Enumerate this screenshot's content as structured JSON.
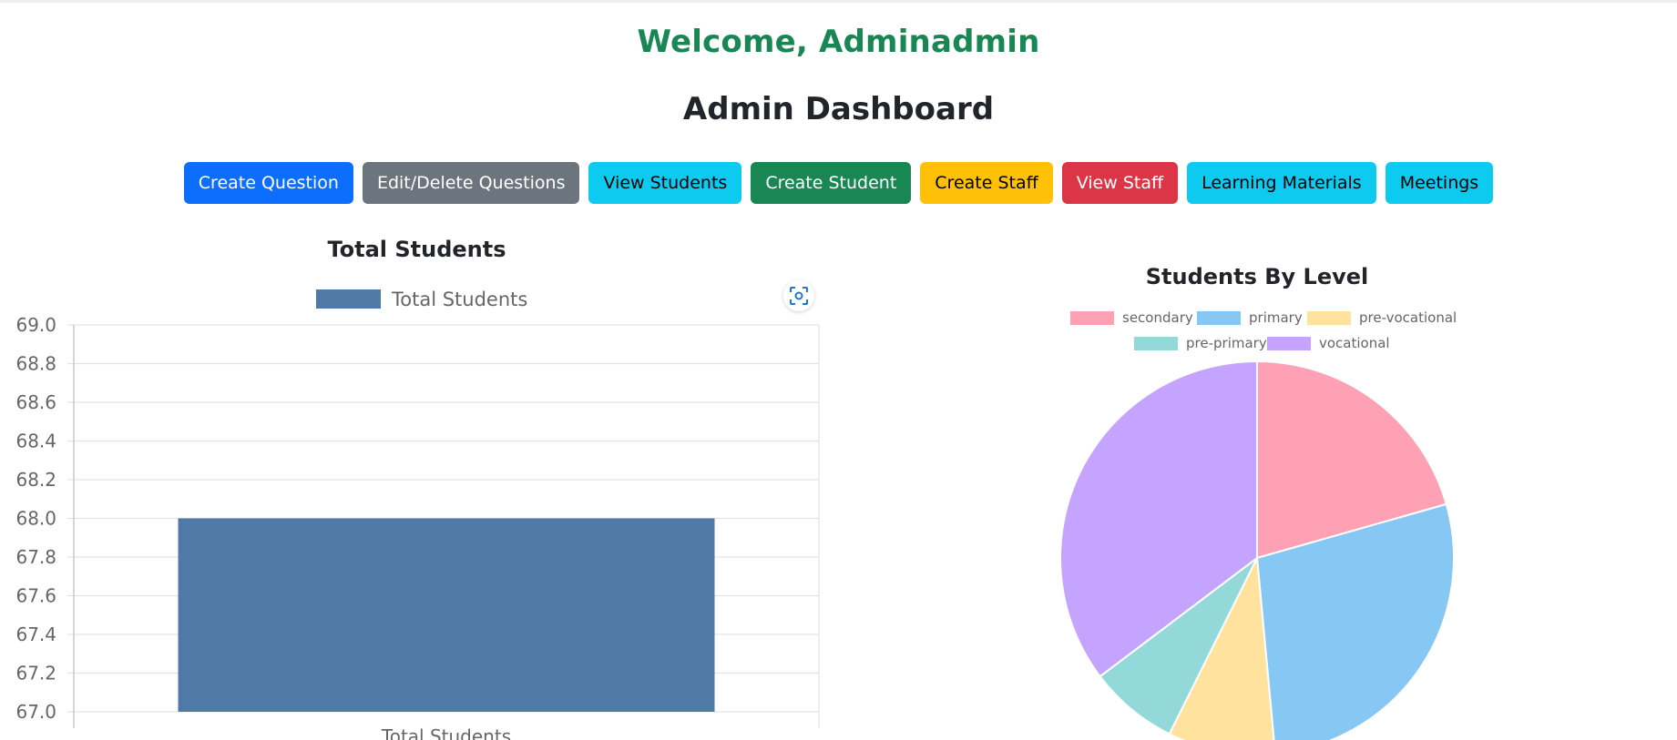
{
  "header": {
    "welcome": "Welcome, Adminadmin",
    "title": "Admin Dashboard"
  },
  "buttons": [
    {
      "label": "Create Question",
      "variant": "primary"
    },
    {
      "label": "Edit/Delete Questions",
      "variant": "secondary"
    },
    {
      "label": "View Students",
      "variant": "info"
    },
    {
      "label": "Create Student",
      "variant": "success"
    },
    {
      "label": "Create Staff",
      "variant": "warning"
    },
    {
      "label": "View Staff",
      "variant": "danger"
    },
    {
      "label": "Learning Materials",
      "variant": "info"
    },
    {
      "label": "Meetings",
      "variant": "info"
    }
  ],
  "colors": {
    "primary": "#0d6efd",
    "secondary": "#6c757d",
    "info": "#0dcaf0",
    "success": "#198754",
    "warning": "#ffc107",
    "danger": "#dc3545"
  },
  "chart_data": [
    {
      "type": "bar",
      "title": "Total Students",
      "categories": [
        "Total Students"
      ],
      "series": [
        {
          "name": "Total Students",
          "values": [
            68
          ],
          "color": "#4f79a7"
        }
      ],
      "ylim": [
        67.0,
        69.0
      ],
      "yticks": [
        "69.0",
        "68.8",
        "68.6",
        "68.4",
        "68.2",
        "68.0",
        "67.8",
        "67.6",
        "67.4",
        "67.2",
        "67.0"
      ],
      "grid": true,
      "legend": "top"
    },
    {
      "type": "pie",
      "title": "Students By Level",
      "categories": [
        "secondary",
        "primary",
        "pre-vocational",
        "pre-primary",
        "vocational"
      ],
      "values": [
        14,
        19,
        6,
        5,
        24
      ],
      "colors": [
        "#ffa1b5",
        "#86c7f3",
        "#ffe29d",
        "#93d9d9",
        "#c4a4ff"
      ],
      "legend": "top"
    }
  ],
  "toolbar": {
    "zoom_icon": "zoom-reset-icon"
  }
}
